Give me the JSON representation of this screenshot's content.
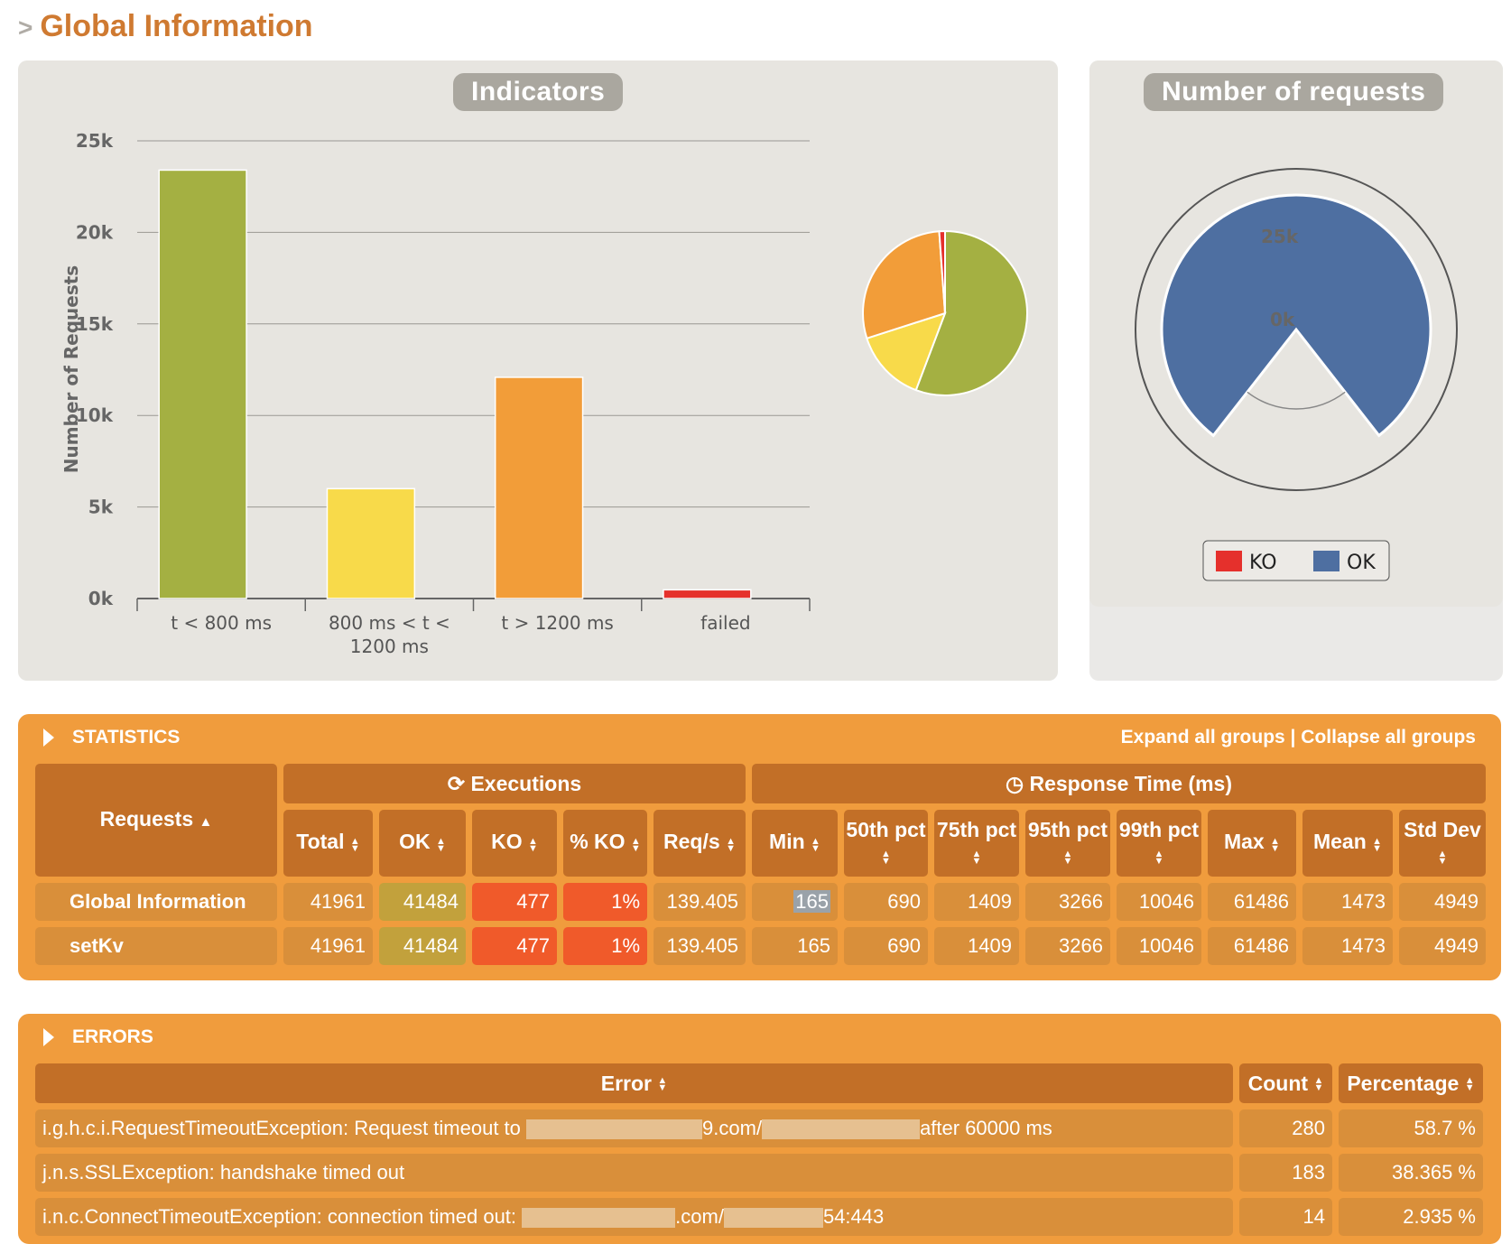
{
  "page_title": "Global Information",
  "indicators": {
    "title": "Indicators"
  },
  "requests_panel": {
    "title": "Number of requests"
  },
  "chart_data": [
    {
      "type": "bar",
      "title": "Indicators",
      "ylabel": "Number of Requests",
      "xlabel": "",
      "categories": [
        "t < 800 ms",
        "800 ms < t < 1200 ms",
        "t > 1200 ms",
        "failed"
      ],
      "values": [
        23400,
        6000,
        12084,
        477
      ],
      "colors": [
        "#a4b042",
        "#f8da4a",
        "#f29d39",
        "#e5302c"
      ],
      "yticks": [
        "0k",
        "5k",
        "10k",
        "15k",
        "20k",
        "25k"
      ],
      "ylim": [
        0,
        25000
      ],
      "grid": true
    },
    {
      "type": "pie",
      "categories": [
        "t < 800 ms",
        "800 ms < t < 1200 ms",
        "t > 1200 ms",
        "failed"
      ],
      "values": [
        23400,
        6000,
        12084,
        477
      ]
    },
    {
      "type": "pie",
      "title": "Number of requests",
      "categories": [
        "KO",
        "OK"
      ],
      "values": [
        477,
        41484
      ],
      "colors": [
        "#e5302c",
        "#4e6fa1"
      ],
      "radial_ticks": [
        "0k",
        "25k"
      ],
      "legend": "bottom"
    }
  ],
  "statistics": {
    "title": "STATISTICS",
    "expand": "Expand all groups",
    "sep": "|",
    "collapse": "Collapse all groups",
    "group_exec": "Executions",
    "group_resp": "Response Time (ms)",
    "headers": [
      "Requests",
      "Total",
      "OK",
      "KO",
      "% KO",
      "Req/s",
      "Min",
      "50th pct",
      "75th pct",
      "95th pct",
      "99th pct",
      "Max",
      "Mean",
      "Std Dev"
    ],
    "rows": [
      [
        "Global Information",
        "41961",
        "41484",
        "477",
        "1%",
        "139.405",
        "165",
        "690",
        "1409",
        "3266",
        "10046",
        "61486",
        "1473",
        "4949"
      ],
      [
        "setKv",
        "41961",
        "41484",
        "477",
        "1%",
        "139.405",
        "165",
        "690",
        "1409",
        "3266",
        "10046",
        "61486",
        "1473",
        "4949"
      ]
    ]
  },
  "errors": {
    "title": "ERRORS",
    "headers": [
      "Error",
      "Count",
      "Percentage"
    ],
    "rows": [
      {
        "a": "i.g.h.c.i.RequestTimeoutException: Request timeout to",
        "b": "9.com/",
        "c": "after 60000 ms",
        "count": "280",
        "pct": "58.7 %"
      },
      {
        "a": "j.n.s.SSLException: handshake timed out",
        "b": "",
        "c": "",
        "count": "183",
        "pct": "38.365 %"
      },
      {
        "a": "i.n.c.ConnectTimeoutException: connection timed out:",
        "b": ".com/",
        "c": "54:443",
        "count": "14",
        "pct": "2.935 %"
      }
    ]
  }
}
